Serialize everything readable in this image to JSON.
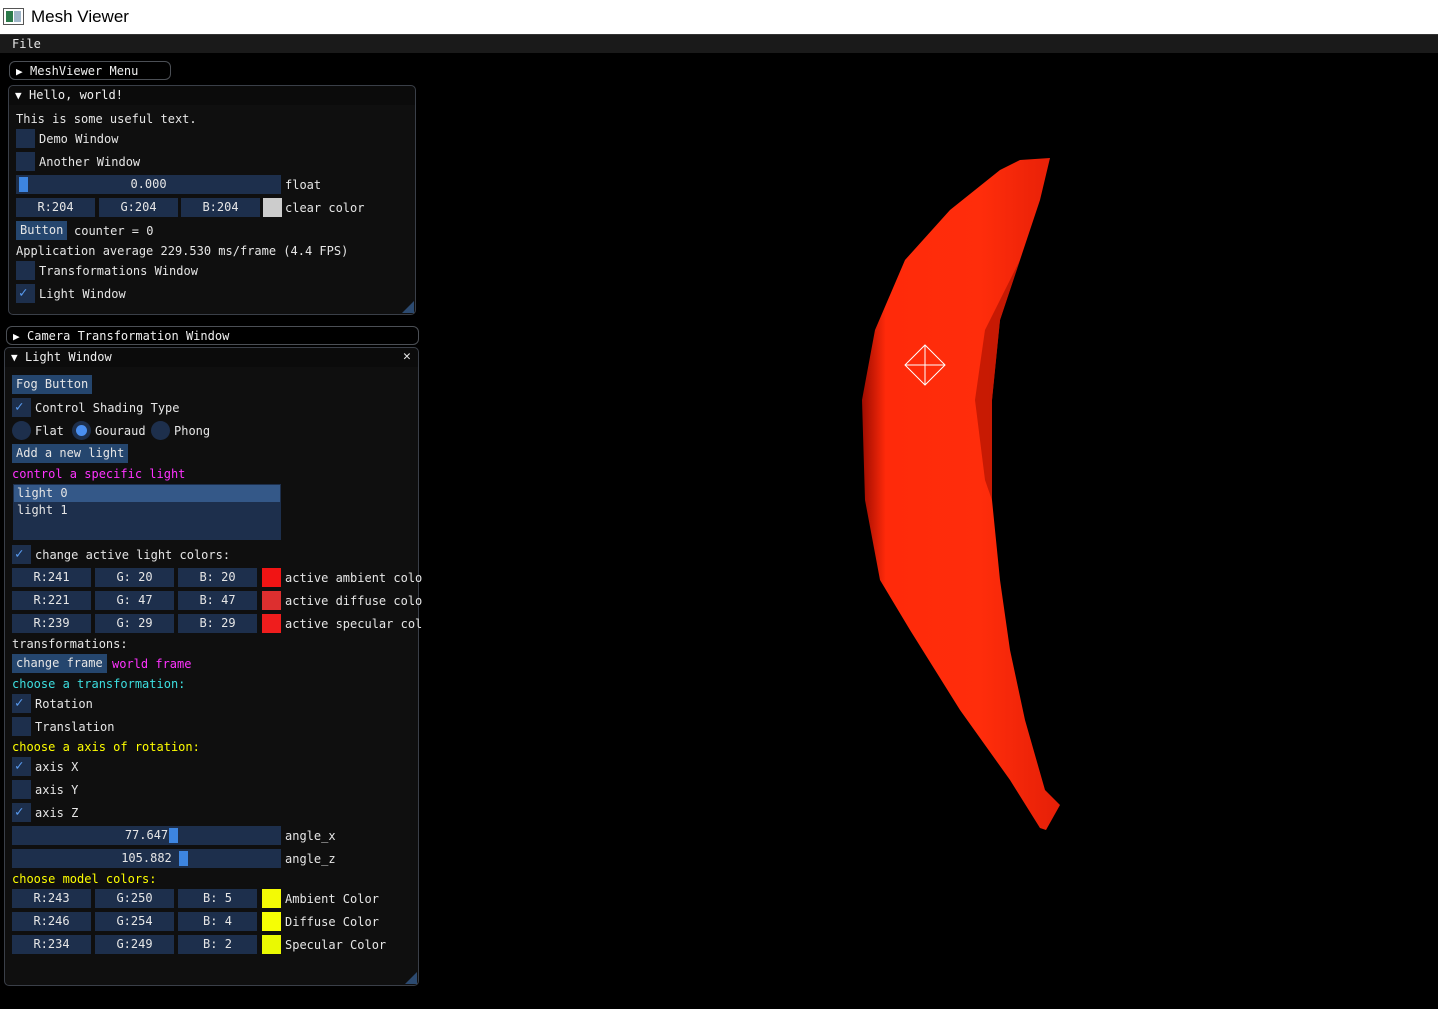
{
  "window": {
    "title": "Mesh Viewer"
  },
  "menubar": {
    "file": "File"
  },
  "meshviewer_menu": {
    "title": "MeshViewer Menu"
  },
  "hello": {
    "title": "Hello, world!",
    "text": "This is some useful text.",
    "demo_window": "Demo Window",
    "another_window": "Another Window",
    "float_value": "0.000",
    "float_fraction": 0.0,
    "float_label": "float",
    "clear_r": "R:204",
    "clear_g": "G:204",
    "clear_b": "B:204",
    "clear_color_label": "clear color",
    "clear_color": "#cccccc",
    "button_label": "Button",
    "counter": "counter = 0",
    "fps": "Application average 229.530 ms/frame (4.4 FPS)",
    "transformations_window": "Transformations Window",
    "light_window": "Light Window"
  },
  "camera": {
    "title": "Camera Transformation Window"
  },
  "light": {
    "title": "Light Window",
    "fog_button": "Fog Button",
    "control_shading": "Control Shading Type",
    "shading": {
      "flat": "Flat",
      "gouraud": "Gouraud",
      "phong": "Phong",
      "selected": "Gouraud"
    },
    "add_light": "Add a new light",
    "control_specific": "control a specific light",
    "lights": [
      "light 0",
      "light 1"
    ],
    "selected_light": "light 0",
    "change_active_colors": "change active light colors:",
    "ambient": {
      "r": "R:241",
      "g": "G: 20",
      "b": "B: 20",
      "label": "active ambient colo",
      "color": "#f11414"
    },
    "diffuse": {
      "r": "R:221",
      "g": "G: 47",
      "b": "B: 47",
      "label": "active diffuse colo",
      "color": "#dd2f2f"
    },
    "specular": {
      "r": "R:239",
      "g": "G: 29",
      "b": "B: 29",
      "label": "active specular col",
      "color": "#ef1d1d"
    },
    "transformations": "transformations:",
    "change_frame": "change frame",
    "frame": "world frame",
    "choose_transformation": "choose a transformation:",
    "rotation": "Rotation",
    "translation": "Translation",
    "choose_axis": "choose a axis of rotation:",
    "axis_x": "axis X",
    "axis_y": "axis Y",
    "axis_z": "axis Z",
    "angle_x_value": "77.647",
    "angle_x_label": "angle_x",
    "angle_z_value": "105.882",
    "angle_z_label": "angle_z",
    "choose_model_colors": "choose model colors:",
    "model_ambient": {
      "r": "R:243",
      "g": "G:250",
      "b": "B:  5",
      "label": "Ambient Color",
      "color": "#f3fa05"
    },
    "model_diffuse": {
      "r": "R:246",
      "g": "G:254",
      "b": "B:  4",
      "label": "Diffuse Color",
      "color": "#f6fe04"
    },
    "model_specular": {
      "r": "R:234",
      "g": "G:249",
      "b": "B:  2",
      "label": "Specular Color",
      "color": "#eaf902"
    }
  },
  "colors": {
    "mesh": "#ff2a0a",
    "accent": "#3d85e0"
  }
}
